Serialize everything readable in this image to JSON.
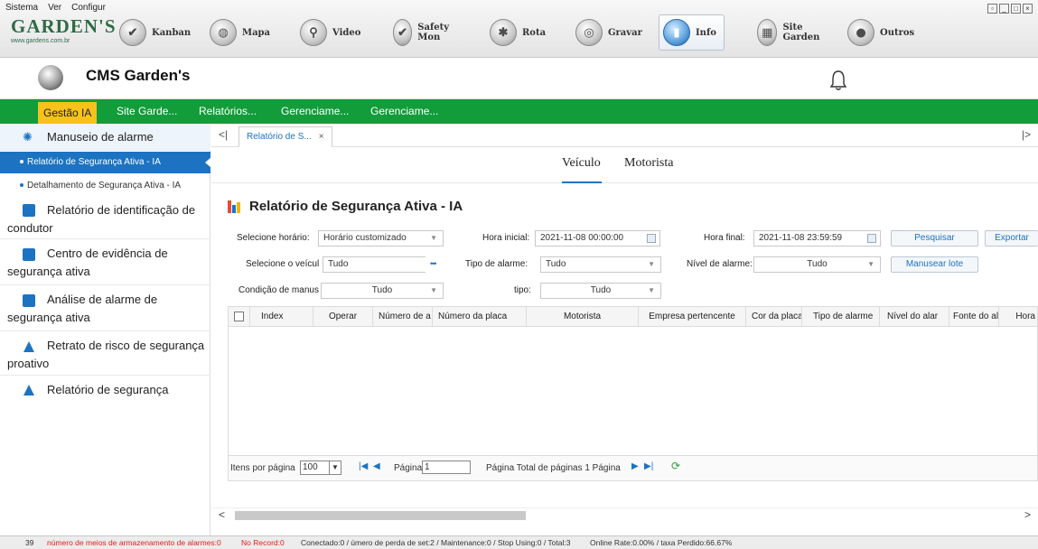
{
  "menu": [
    "Sistema",
    "Ver",
    "Configur"
  ],
  "logo": {
    "name": "GARDEN'S",
    "url": "www.gardens.com.br"
  },
  "modules": [
    {
      "label": "Kanban",
      "icon": "kanban-icon"
    },
    {
      "label": "Mapa",
      "icon": "globe-icon"
    },
    {
      "label": "Video",
      "icon": "video-icon"
    },
    {
      "label": "Safety Mon",
      "icon": "shield-icon"
    },
    {
      "label": "Rota",
      "icon": "route-icon"
    },
    {
      "label": "Gravar",
      "icon": "record-icon"
    },
    {
      "label": "Info",
      "icon": "info-chart-icon",
      "active": true
    },
    {
      "label": "Site Garden",
      "icon": "building-icon"
    },
    {
      "label": "Outros",
      "icon": "other-icon"
    }
  ],
  "header": {
    "title": "CMS Garden's"
  },
  "nav": [
    "Gestão IA",
    "Site Garde...",
    "Relatórios...",
    "Gerenciame...",
    "Gerenciame..."
  ],
  "sidebar": {
    "section_alarm": "Manuseio de alarme",
    "sub_items": [
      "Relatório de Segurança Ativa - IA",
      "Detalhamento de Segurança Ativa - IA"
    ],
    "groups": [
      "Relatório de identificação de condutor",
      "Centro de evidência de segurança ativa",
      "Análise de alarme de segurança ativa",
      "Retrato de risco de segurança proativo",
      "Relatório de segurança"
    ]
  },
  "tabs": {
    "open_tab": "Relatório de S...",
    "close": "×"
  },
  "subtabs": [
    "Veículo",
    "Motorista"
  ],
  "report": {
    "title": "Relatório de Segurança Ativa - IA",
    "filters": {
      "time_label": "Selecione horário:",
      "time_value": "Horário customizado",
      "start_label": "Hora inicial:",
      "start_value": "2021-11-08 00:00:00",
      "end_label": "Hora final:",
      "end_value": "2021-11-08 23:59:59",
      "vehicle_label": "Selecione o veícul",
      "vehicle_value": "Tudo",
      "alarm_type_label": "Tipo de alarme:",
      "alarm_type_value": "Tudo",
      "alarm_level_label": "Nível de alarme:",
      "alarm_level_value": "Tudo",
      "handling_label": "Condição de manus",
      "handling_value": "Tudo",
      "type_label": "tipo:",
      "type_value": "Tudo",
      "ellipsis": "•••"
    },
    "buttons": {
      "search": "Pesquisar",
      "export": "Exportar",
      "batch": "Manusear lote"
    },
    "columns": [
      "Index",
      "Operar",
      "Número de a",
      "Número da placa",
      "Motorista",
      "Empresa pertencente",
      "Cor da placa",
      "Tipo de alarme",
      "Nível do alar",
      "Fonte do ala",
      "Hora"
    ]
  },
  "pager": {
    "per_page_label": "Itens por página",
    "per_page_value": "100",
    "page_label": "Página",
    "page_value": "1",
    "total_text": "Página  Total de páginas 1 Página"
  },
  "status": {
    "count": "39",
    "storage": "número de meios de armazenamento de alarmes:0",
    "record": "No Record:0",
    "connection": "Conectado:0 / úmero de perda de set:2 / Maintenance:0 / Stop Using:0 / Total:3",
    "online": "Online Rate:0.00% / taxa Perdido:66.67%"
  },
  "colors": {
    "nav_green": "#129c3a",
    "nav_active": "#f6c21b",
    "accent_blue": "#1c73c2",
    "status_red": "#e01e1e"
  }
}
